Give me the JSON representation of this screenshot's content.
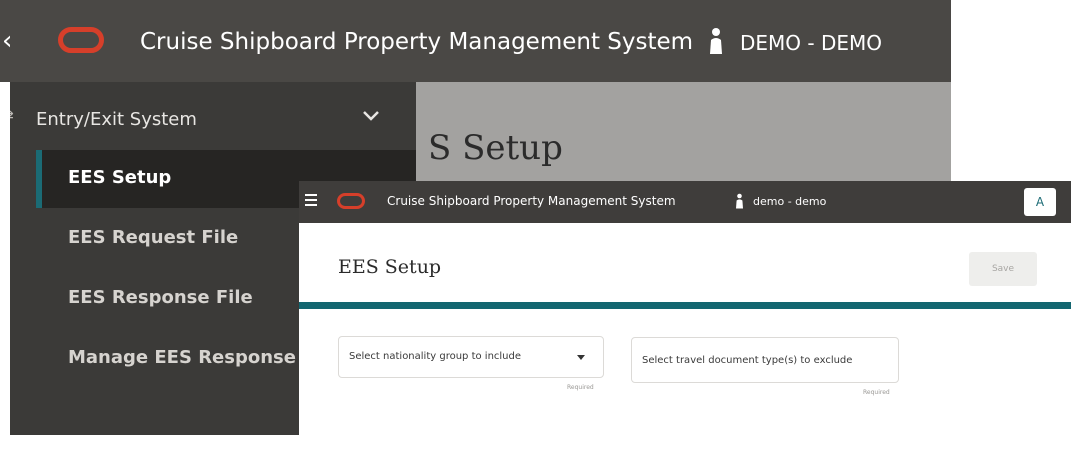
{
  "background": {
    "header": {
      "back_icon": "chevron-left-icon",
      "logo": "oracle-logo",
      "title": "Cruise Shipboard Property Management System",
      "user_icon": "user-icon",
      "user": "DEMO - DEMO"
    },
    "sidebar": {
      "section_icon": "swap-icon",
      "section_label": "Entry/Exit System",
      "section_chevron": "chevron-down-icon",
      "items": [
        {
          "label": "EES Setup",
          "active": true
        },
        {
          "label": "EES Request File",
          "active": false
        },
        {
          "label": "EES Response File",
          "active": false
        },
        {
          "label": "Manage EES Response St",
          "active": false
        }
      ]
    },
    "page_title": "S Setup"
  },
  "foreground": {
    "header": {
      "menu_icon": "hamburger-icon",
      "logo": "oracle-logo",
      "title": "Cruise Shipboard Property Management System",
      "user_icon": "user-icon",
      "user": "demo - demo",
      "avatar": "A"
    },
    "page_title": "EES Setup",
    "save_label": "Save",
    "fields": [
      {
        "label": "Select nationality group to include",
        "required": "Required",
        "type": "select"
      },
      {
        "label": "Select travel document type(s) to exclude",
        "required": "Required",
        "type": "input"
      }
    ]
  },
  "colors": {
    "header_bg": "#4a4845",
    "sidebar_bg": "#3b3a38",
    "active_item_bg": "#262523",
    "accent_teal": "#136670",
    "logo_red": "#d63f2a"
  }
}
